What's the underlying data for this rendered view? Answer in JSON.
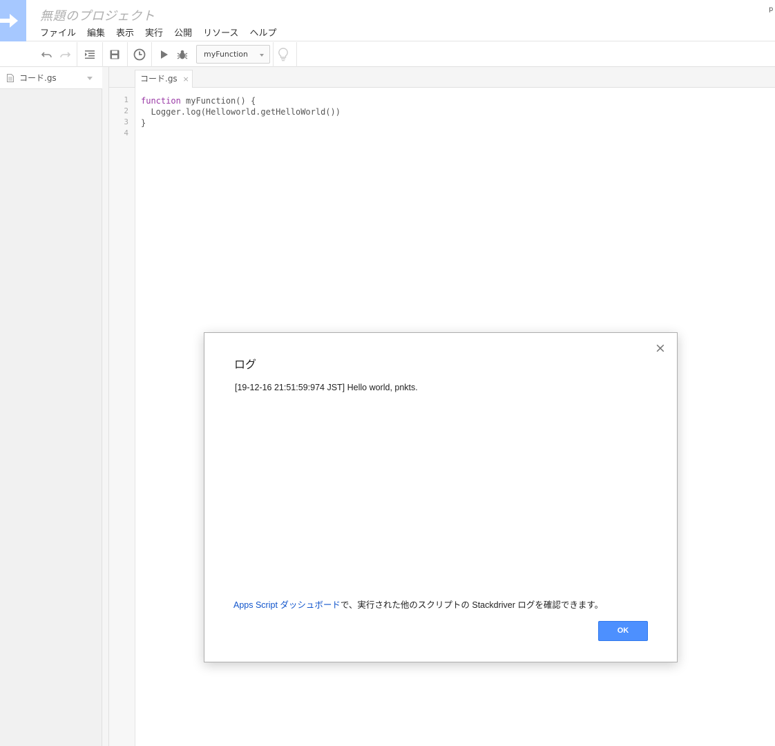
{
  "header": {
    "project_title": "無題のプロジェクト",
    "user_fragment": "p",
    "menu": [
      "ファイル",
      "編集",
      "表示",
      "実行",
      "公開",
      "リソース",
      "ヘルプ"
    ]
  },
  "toolbar": {
    "function_select": "myFunction",
    "icons": [
      "undo-icon",
      "redo-icon",
      "indent-icon",
      "save-icon",
      "trigger-clock-icon",
      "run-icon",
      "debug-icon",
      "lightbulb-icon"
    ]
  },
  "sidebar": {
    "files": [
      {
        "name": "コード.gs"
      }
    ]
  },
  "editor": {
    "tab_label": "コード.gs",
    "tab_close": "×",
    "line_numbers": [
      "1",
      "2",
      "3",
      "4"
    ],
    "lines": [
      {
        "keyword": "function",
        "rest": " myFunction() {"
      },
      {
        "keyword": "",
        "rest": "  Logger.log(Helloworld.getHelloWorld())"
      },
      {
        "keyword": "",
        "rest": "}"
      },
      {
        "keyword": "",
        "rest": ""
      }
    ]
  },
  "dialog": {
    "title": "ログ",
    "close": "×",
    "log_text": "[19-12-16 21:51:59:974 JST] Hello world, pnkts.",
    "footer_link": "Apps Script ダッシュボード",
    "footer_text": "で、実行された他のスクリプトの Stackdriver ログを確認できます。",
    "ok_label": "OK"
  },
  "colors": {
    "logo_bg": "#a6c8ff",
    "keyword": "#9a3aa6",
    "link": "#1155cc",
    "ok_button": "#4d90fe"
  }
}
